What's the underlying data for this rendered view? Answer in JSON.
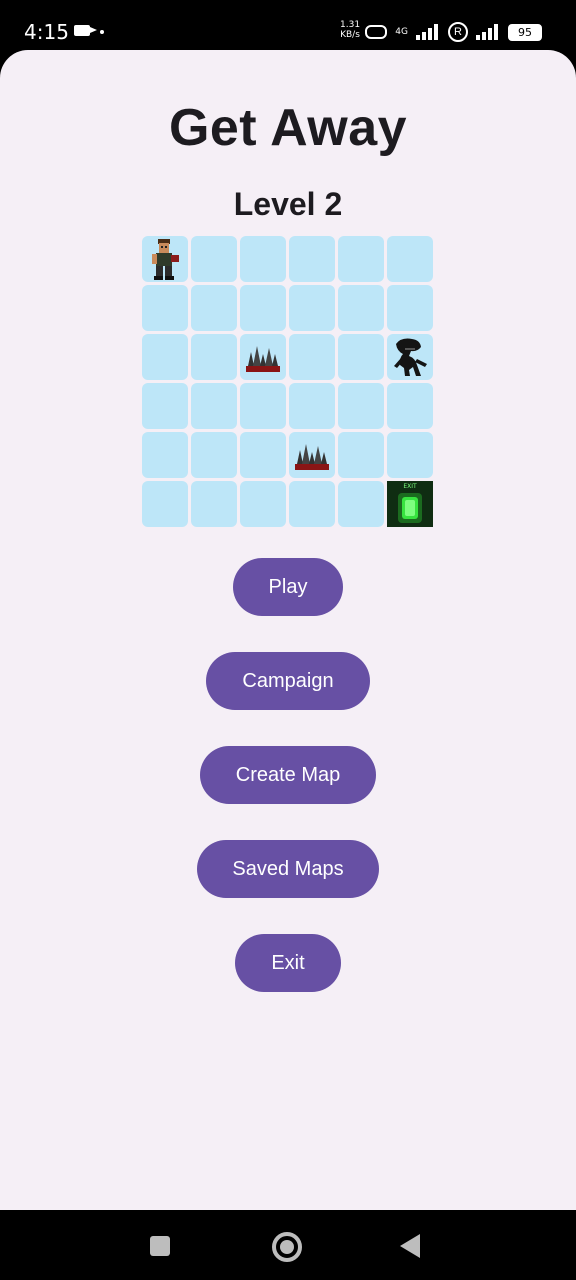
{
  "status_bar": {
    "time": "4:15",
    "speed_value": "1.31",
    "speed_unit": "KB/s",
    "network": "4G",
    "r_symbol": "R",
    "battery": "95"
  },
  "app": {
    "title": "Get Away",
    "level": "Level 2",
    "colors": {
      "background": "#f5eff6",
      "button": "#6750a4",
      "tile": "#bde6f8",
      "text": "#1d1b20"
    }
  },
  "board": {
    "rows": 6,
    "cols": 6,
    "pieces": [
      {
        "type": "player",
        "icon": "player-icon",
        "row": 1,
        "col": 1
      },
      {
        "type": "alien",
        "icon": "alien-icon",
        "row": 3,
        "col": 6
      },
      {
        "type": "spikes",
        "icon": "spikes-icon",
        "row": 3,
        "col": 3
      },
      {
        "type": "spikes",
        "icon": "spikes-icon",
        "row": 5,
        "col": 4
      },
      {
        "type": "exit",
        "icon": "exit-door-icon",
        "row": 6,
        "col": 6,
        "label": "EXIT"
      }
    ]
  },
  "menu": {
    "play": "Play",
    "campaign": "Campaign",
    "create_map": "Create Map",
    "saved_maps": "Saved Maps",
    "exit": "Exit"
  },
  "nav_bar": {
    "recents": "square-icon",
    "home": "circle-home-icon",
    "back": "back-triangle-icon"
  }
}
